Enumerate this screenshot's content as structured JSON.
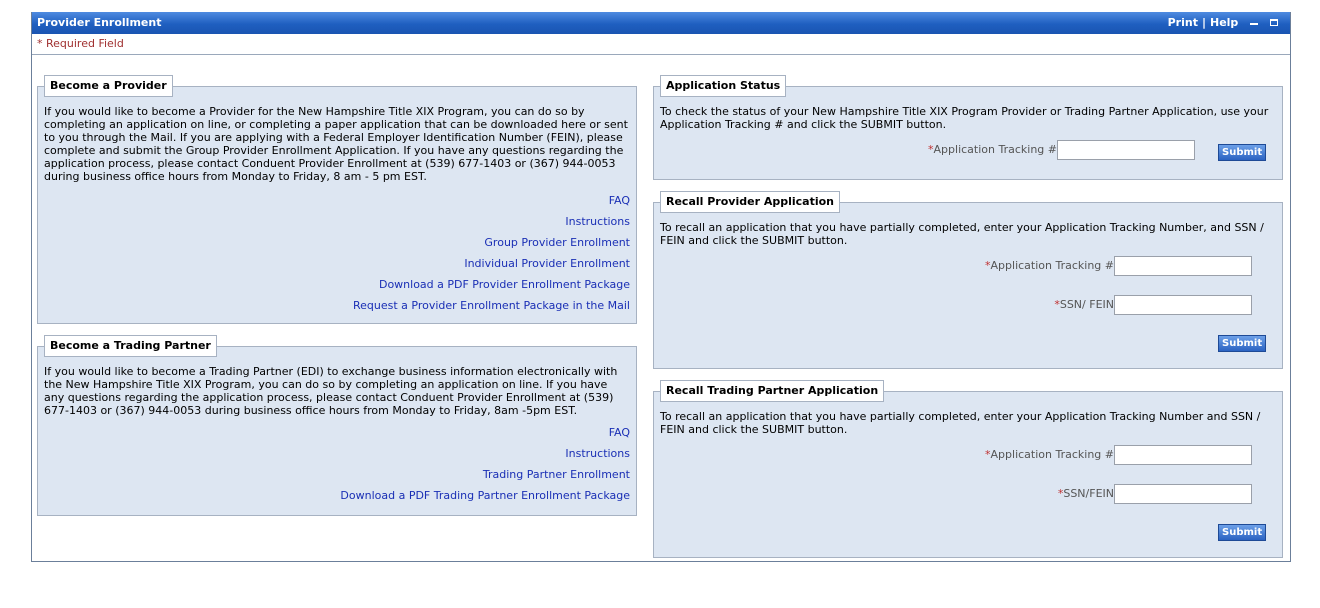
{
  "window": {
    "title": "Provider Enrollment",
    "print_label": "Print",
    "separator": "|",
    "help_label": "Help"
  },
  "required_note": "* Required Field",
  "become_provider": {
    "legend": "Become a Provider",
    "description": "If you would like to become a Provider for the New Hampshire Title XIX Program, you can do so by completing an application on line, or completing a paper application that can be downloaded here or sent to you through the Mail. If you are applying with a Federal Employer Identification Number (FEIN), please complete and submit the Group Provider Enrollment Application. If you have any questions regarding the application process, please contact Conduent Provider Enrollment at (539) 677-1403 or (367) 944-0053 during business office hours from Monday to Friday, 8 am - 5 pm EST.",
    "links": [
      "FAQ",
      "Instructions",
      "Group Provider Enrollment",
      "Individual Provider Enrollment",
      "Download a PDF Provider Enrollment Package",
      "Request a Provider Enrollment Package in the Mail"
    ]
  },
  "become_trading_partner": {
    "legend": "Become a Trading Partner",
    "description": "If you would like to become a Trading Partner (EDI) to exchange business information electronically with the New Hampshire Title XIX Program, you can do so by completing an application on line. If you have any questions regarding the application process, please contact Conduent Provider Enrollment at (539) 677-1403 or (367) 944-0053 during business office hours from Monday to Friday, 8am -5pm EST.",
    "links": [
      "FAQ",
      "Instructions",
      "Trading Partner Enrollment",
      "Download a PDF Trading Partner Enrollment Package"
    ]
  },
  "application_status": {
    "legend": "Application Status",
    "description": "To check the status of your New Hampshire Title XIX Program Provider or Trading Partner Application, use your Application Tracking # and click the SUBMIT button.",
    "required_mark": "*",
    "tracking_label": "Application Tracking #",
    "tracking_value": "",
    "submit_label": "Submit"
  },
  "recall_provider": {
    "legend": "Recall Provider Application",
    "description": "To recall an application that you have partially completed, enter your Application Tracking Number, and SSN / FEIN and click the SUBMIT button.",
    "required_mark": "*",
    "tracking_label": "Application Tracking #",
    "tracking_value": "",
    "ssn_label": "SSN/ FEIN",
    "ssn_value": "",
    "submit_label": "Submit"
  },
  "recall_trading_partner": {
    "legend": "Recall Trading Partner Application",
    "description": "To recall an application that you have partially completed, enter your Application Tracking Number and SSN / FEIN and click the SUBMIT button.",
    "required_mark": "*",
    "tracking_label": "Application Tracking #",
    "tracking_value": "",
    "ssn_label": "SSN/FEIN",
    "ssn_value": "",
    "submit_label": "Submit"
  },
  "icons": {
    "minimize": "minimize-icon",
    "maximize": "maximize-icon"
  },
  "colors": {
    "titlebar": "#1f5fc0",
    "panel": "#dde6f2",
    "link": "#1a2fb5",
    "required": "#c03030"
  }
}
